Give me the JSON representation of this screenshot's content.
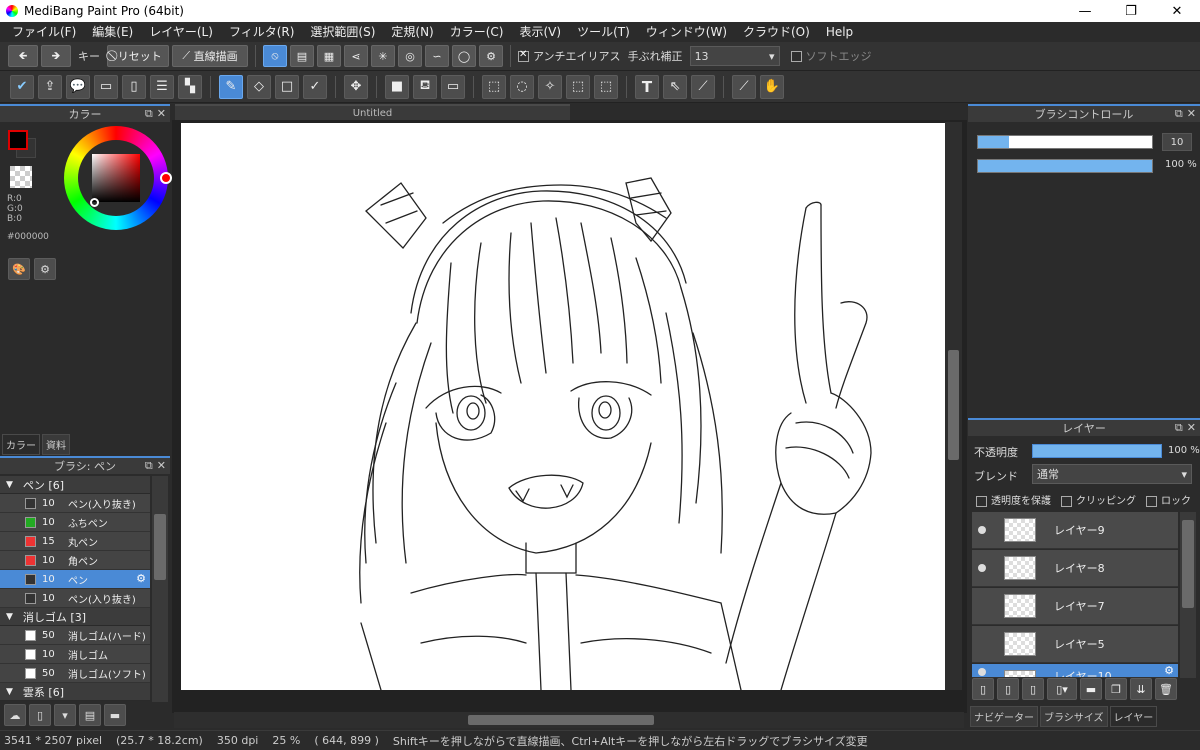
{
  "window": {
    "title": "MediBang Paint Pro (64bit)",
    "minimize": "—",
    "maximize": "❐",
    "close": "✕"
  },
  "menu": [
    "ファイル(F)",
    "編集(E)",
    "レイヤー(L)",
    "フィルタ(R)",
    "選択範囲(S)",
    "定規(N)",
    "カラー(C)",
    "表示(V)",
    "ツール(T)",
    "ウィンドウ(W)",
    "クラウド(O)",
    "Help"
  ],
  "toolbar1": {
    "key_label": "キー",
    "reset_label": "リセット",
    "line_label": "直線描画",
    "antialias_label": "アンチエイリアス",
    "stabilizer_label": "手ぶれ補正",
    "stabilizer_value": "13",
    "soft_edge_label": "ソフトエッジ"
  },
  "color_panel": {
    "title": "カラー",
    "r": "R:0",
    "g": "G:0",
    "b": "B:0",
    "hex": "#000000",
    "tabs": [
      "カラー",
      "資料"
    ],
    "fg_color": "#000000",
    "accent": "#4a8ad6"
  },
  "brush_panel": {
    "title": "ブラシ: ペン",
    "groups": [
      {
        "name": "ペン [6]",
        "items": [
          {
            "size": "10",
            "name": "ペン(入り抜き)",
            "color": "#333333"
          },
          {
            "size": "10",
            "name": "ふちペン",
            "color": "#22aa22"
          },
          {
            "size": "15",
            "name": "丸ペン",
            "color": "#ee3333"
          },
          {
            "size": "10",
            "name": "角ペン",
            "color": "#ee3333"
          },
          {
            "size": "10",
            "name": "ペン",
            "color": "#333333",
            "selected": true
          },
          {
            "size": "10",
            "name": "ペン(入り抜き)",
            "color": "#333333"
          }
        ]
      },
      {
        "name": "消しゴム [3]",
        "items": [
          {
            "size": "50",
            "name": "消しゴム(ハード)",
            "color": "#ffffff"
          },
          {
            "size": "10",
            "name": "消しゴム",
            "color": "#ffffff"
          },
          {
            "size": "50",
            "name": "消しゴム(ソフト)",
            "color": "#ffffff"
          }
        ]
      },
      {
        "name": "雲系 [6]",
        "items": []
      }
    ]
  },
  "document": {
    "tab_title": "Untitled"
  },
  "brush_control": {
    "title": "ブラシコントロール",
    "size": "10",
    "size_fill": 0.18,
    "opacity": "100 %",
    "opacity_fill": 1.0
  },
  "layer_panel": {
    "title": "レイヤー",
    "opacity_label": "不透明度",
    "opacity_value": "100 %",
    "blend_label": "ブレンド",
    "blend_value": "通常",
    "protect_alpha": "透明度を保護",
    "clipping": "クリッピング",
    "lock": "ロック",
    "layers": [
      {
        "name": "レイヤー9",
        "visible": true,
        "selected": false
      },
      {
        "name": "レイヤー8",
        "visible": true,
        "selected": false
      },
      {
        "name": "レイヤー7",
        "visible": false,
        "selected": false
      },
      {
        "name": "レイヤー5",
        "visible": false,
        "selected": false
      },
      {
        "name": "レイヤー10",
        "visible": true,
        "selected": true
      }
    ],
    "tabs": [
      "ナビゲーター",
      "ブラシサイズ",
      "レイヤー"
    ]
  },
  "status": {
    "size": "3541 * 2507 pixel",
    "cm": "(25.7 * 18.2cm)",
    "dpi": "350 dpi",
    "zoom": "25 %",
    "coords": "( 644, 899 )",
    "hint": "Shiftキーを押しながらで直線描画、Ctrl+Altキーを押しながら左右ドラッグでブラシサイズ変更"
  }
}
